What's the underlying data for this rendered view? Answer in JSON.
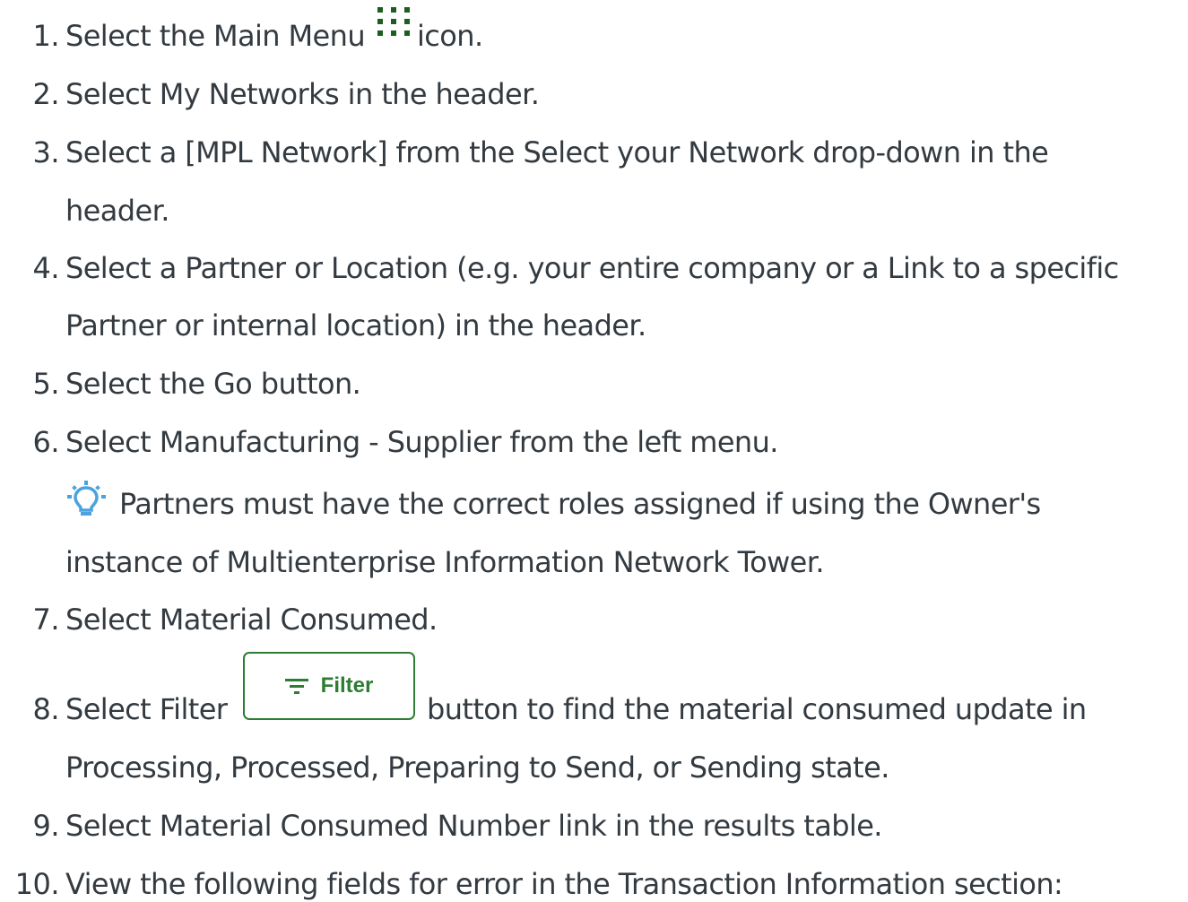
{
  "steps": [
    {
      "num": "1.",
      "parts": [
        "Select the Main Menu",
        "icon."
      ]
    },
    {
      "num": "2.",
      "lines": [
        "Select My Networks in the header."
      ]
    },
    {
      "num": "3.",
      "lines": [
        "Select a [MPL Network] from the Select your Network drop-down in the",
        "header."
      ]
    },
    {
      "num": "4.",
      "lines": [
        "Select a Partner or Location (e.g. your entire company or a Link to a specific",
        "Partner or internal location) in the header."
      ]
    },
    {
      "num": "5.",
      "lines": [
        "Select the Go button."
      ]
    },
    {
      "num": "6.",
      "lines": [
        " Select Manufacturing - Supplier from the left menu."
      ],
      "tip": [
        "Partners must have the correct roles assigned if using the Owner's",
        "instance of Multienterprise Information Network Tower."
      ]
    },
    {
      "num": "7.",
      "lines": [
        "Select Material Consumed."
      ]
    },
    {
      "num": "8.",
      "parts": [
        "Select Filter",
        "button to find the material consumed update in"
      ],
      "lines": [
        "Processing, Processed, Preparing to Send, or Sending state."
      ],
      "filter_label": "Filter"
    },
    {
      "num": "9.",
      "lines": [
        "Select Material Consumed Number link in the results table."
      ]
    },
    {
      "num": "10.",
      "lines": [
        "View the following fields for error in the Transaction Information section:"
      ]
    }
  ],
  "icons": {
    "main_menu": "grid-dots-icon",
    "tip": "lightbulb-icon",
    "filter": "filter-lines-icon"
  },
  "colors": {
    "text": "#333a40",
    "accent_green": "#2e7d32",
    "tip_blue": "#4aa3df"
  }
}
